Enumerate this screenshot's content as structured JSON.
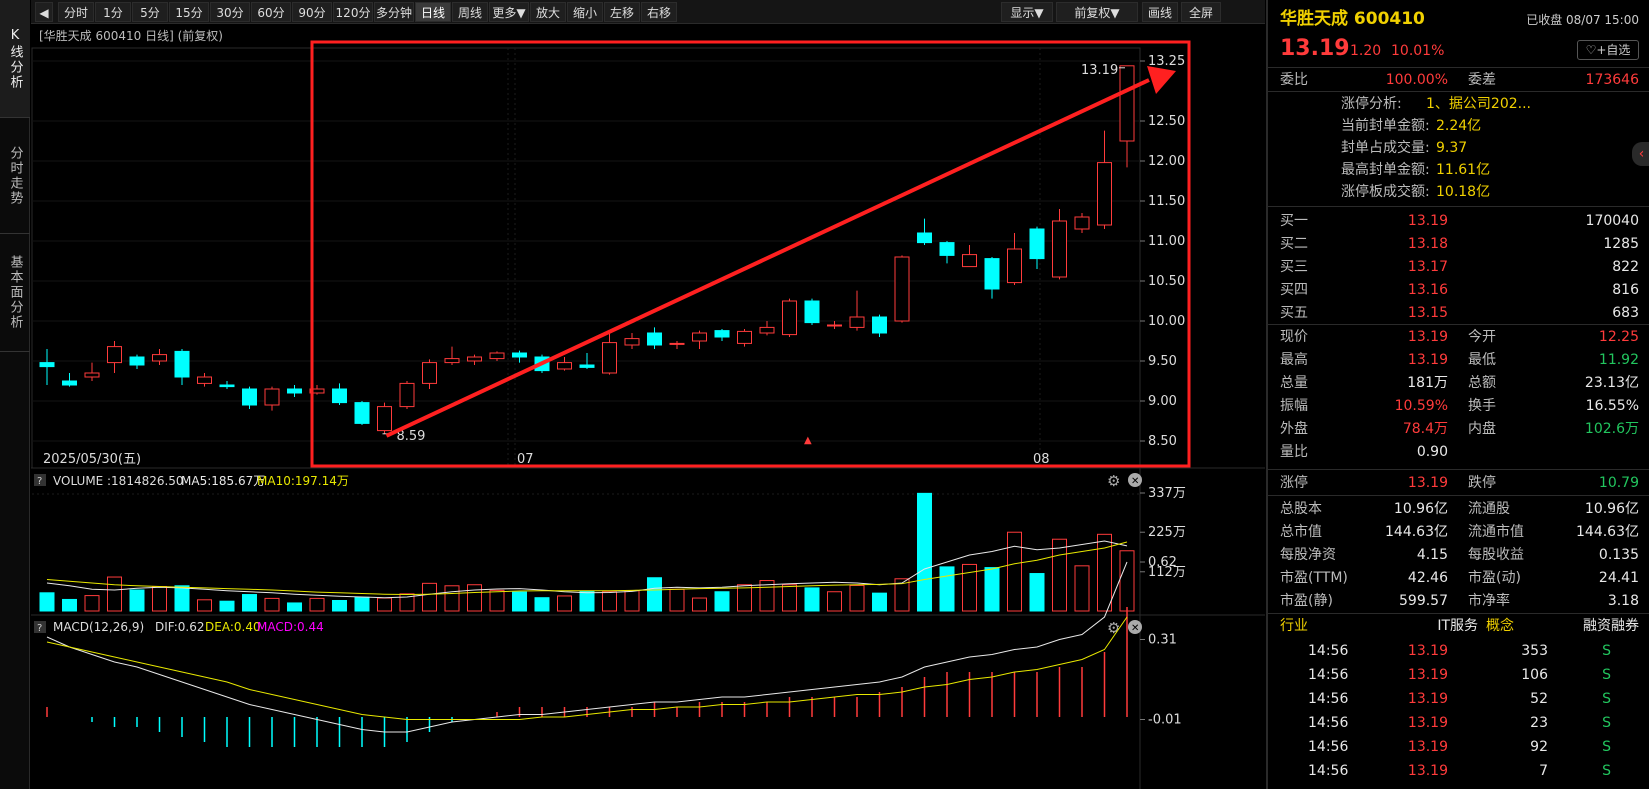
{
  "toolbar": {
    "items": [
      "分时",
      "1分",
      "5分",
      "15分",
      "30分",
      "60分",
      "90分",
      "120分",
      "多分钟",
      "日线",
      "周线",
      "更多▼",
      "放大",
      "缩小",
      "左移",
      "右移"
    ],
    "right_items": [
      "显示▼",
      "前复权▼",
      "画线",
      "全屏"
    ],
    "active": "日线"
  },
  "left_tabs": [
    "K线分析",
    "分时走势",
    "基本面分析"
  ],
  "chart": {
    "header": "[华胜天成 600410 日线] (前复权)",
    "date_label": "2025/05/30(五)",
    "month_labels": [
      "07",
      "08"
    ],
    "y_ticks": [
      "13.25",
      "12.50",
      "12.00",
      "11.50",
      "11.00",
      "10.50",
      "10.00",
      "9.50",
      "9.00",
      "8.50"
    ],
    "high_label": "13.19",
    "low_label": "8.59",
    "volume_header": {
      "name": "VOLUME",
      "value": ":1814826.50",
      "ma5": "MA5:185.67万",
      "ma10": "MA10:197.14万"
    },
    "volume_ticks": [
      "337万",
      "225万",
      "112万"
    ],
    "macd_header": {
      "name": "MACD(12,26,9)",
      "dif": "DIF:0.62",
      "dea": "DEA:0.40",
      "macd": "MACD:0.44"
    },
    "macd_ticks": [
      "0.62",
      "0.31",
      "-0.01"
    ]
  },
  "chart_data": {
    "type": "candlestick",
    "candles": [
      [
        9.48,
        9.43,
        9.65,
        9.2
      ],
      [
        9.25,
        9.2,
        9.35,
        9.18
      ],
      [
        9.3,
        9.35,
        9.48,
        9.25
      ],
      [
        9.48,
        9.68,
        9.75,
        9.35
      ],
      [
        9.55,
        9.45,
        9.58,
        9.4
      ],
      [
        9.5,
        9.58,
        9.65,
        9.45
      ],
      [
        9.62,
        9.3,
        9.65,
        9.2
      ],
      [
        9.22,
        9.3,
        9.35,
        9.18
      ],
      [
        9.2,
        9.18,
        9.25,
        9.15
      ],
      [
        9.15,
        8.95,
        9.18,
        8.9
      ],
      [
        8.95,
        9.15,
        9.18,
        8.88
      ],
      [
        9.15,
        9.1,
        9.2,
        9.05
      ],
      [
        9.1,
        9.15,
        9.2,
        9.08
      ],
      [
        9.15,
        8.98,
        9.22,
        8.95
      ],
      [
        8.98,
        8.72,
        9.0,
        8.7
      ],
      [
        8.63,
        8.93,
        8.98,
        8.59
      ],
      [
        8.93,
        9.22,
        9.25,
        8.9
      ],
      [
        9.22,
        9.48,
        9.52,
        9.15
      ],
      [
        9.48,
        9.53,
        9.68,
        9.45
      ],
      [
        9.5,
        9.55,
        9.58,
        9.45
      ],
      [
        9.53,
        9.6,
        9.62,
        9.5
      ],
      [
        9.6,
        9.55,
        9.63,
        9.48
      ],
      [
        9.55,
        9.38,
        9.58,
        9.35
      ],
      [
        9.4,
        9.48,
        9.55,
        9.38
      ],
      [
        9.45,
        9.42,
        9.6,
        9.4
      ],
      [
        9.35,
        9.73,
        9.85,
        9.33
      ],
      [
        9.7,
        9.78,
        9.85,
        9.65
      ],
      [
        9.85,
        9.7,
        9.92,
        9.65
      ],
      [
        9.72,
        9.72,
        9.75,
        9.65
      ],
      [
        9.75,
        9.85,
        9.88,
        9.65
      ],
      [
        9.88,
        9.8,
        9.9,
        9.75
      ],
      [
        9.72,
        9.87,
        9.9,
        9.68
      ],
      [
        9.85,
        9.92,
        10.0,
        9.82
      ],
      [
        9.83,
        10.25,
        10.28,
        9.8
      ],
      [
        10.25,
        9.98,
        10.28,
        9.95
      ],
      [
        9.95,
        9.95,
        10.0,
        9.9
      ],
      [
        9.92,
        10.05,
        10.38,
        9.88
      ],
      [
        10.05,
        9.85,
        10.08,
        9.8
      ],
      [
        10.0,
        10.8,
        10.82,
        9.98
      ],
      [
        11.1,
        10.98,
        11.28,
        10.95
      ],
      [
        10.98,
        10.82,
        11.0,
        10.72
      ],
      [
        10.68,
        10.83,
        10.95,
        10.68
      ],
      [
        10.78,
        10.4,
        10.8,
        10.28
      ],
      [
        10.48,
        10.9,
        11.1,
        10.45
      ],
      [
        11.15,
        10.78,
        11.18,
        10.65
      ],
      [
        10.55,
        11.25,
        11.4,
        10.52
      ],
      [
        11.15,
        11.3,
        11.35,
        11.1
      ],
      [
        11.2,
        11.98,
        12.38,
        11.15
      ],
      [
        12.25,
        13.19,
        13.19,
        11.92
      ]
    ],
    "volume": [
      52,
      33,
      44,
      97,
      60,
      70,
      72,
      32,
      28,
      47,
      36,
      23,
      36,
      30,
      39,
      37,
      49,
      79,
      72,
      75,
      59,
      54,
      38,
      43,
      56,
      55,
      58,
      95,
      62,
      37,
      55,
      75,
      87,
      75,
      66,
      55,
      73,
      51,
      92,
      336,
      126,
      133,
      124,
      225,
      107,
      205,
      129,
      219,
      172
    ],
    "vol_ma5": [
      80,
      72,
      62,
      60,
      65,
      68,
      66,
      62,
      58,
      55,
      52,
      48,
      45,
      42,
      40,
      38,
      40,
      48,
      55,
      60,
      63,
      64,
      60,
      55,
      52,
      53,
      56,
      65,
      68,
      66,
      68,
      72,
      75,
      78,
      80,
      82,
      80,
      75,
      80,
      120,
      140,
      160,
      170,
      185,
      175,
      180,
      190,
      200,
      186
    ],
    "vol_ma10": [
      90,
      85,
      80,
      75,
      72,
      70,
      68,
      66,
      64,
      62,
      60,
      57,
      54,
      52,
      50,
      48,
      47,
      48,
      50,
      53,
      55,
      57,
      58,
      58,
      58,
      58,
      59,
      60,
      62,
      64,
      65,
      66,
      68,
      70,
      72,
      74,
      75,
      76,
      78,
      90,
      100,
      110,
      120,
      135,
      145,
      160,
      170,
      180,
      197
    ],
    "dif": [
      0.32,
      0.28,
      0.25,
      0.22,
      0.2,
      0.17,
      0.14,
      0.11,
      0.08,
      0.05,
      0.03,
      0.01,
      -0.01,
      -0.03,
      -0.05,
      -0.06,
      -0.06,
      -0.04,
      -0.02,
      -0.01,
      0.0,
      0.01,
      0.01,
      0.02,
      0.03,
      0.04,
      0.05,
      0.06,
      0.06,
      0.07,
      0.08,
      0.08,
      0.09,
      0.1,
      0.11,
      0.12,
      0.13,
      0.14,
      0.16,
      0.2,
      0.22,
      0.24,
      0.25,
      0.27,
      0.28,
      0.31,
      0.33,
      0.4,
      0.62
    ],
    "dea": [
      0.3,
      0.28,
      0.26,
      0.24,
      0.22,
      0.2,
      0.18,
      0.16,
      0.14,
      0.11,
      0.09,
      0.07,
      0.05,
      0.03,
      0.01,
      0.0,
      -0.01,
      -0.01,
      -0.01,
      -0.01,
      -0.01,
      -0.01,
      0.0,
      0.0,
      0.01,
      0.02,
      0.03,
      0.03,
      0.04,
      0.04,
      0.05,
      0.05,
      0.06,
      0.06,
      0.07,
      0.08,
      0.09,
      0.09,
      0.1,
      0.12,
      0.13,
      0.15,
      0.16,
      0.18,
      0.19,
      0.21,
      0.23,
      0.27,
      0.4
    ],
    "macd": [
      0.04,
      0.0,
      -0.02,
      -0.04,
      -0.04,
      -0.06,
      -0.08,
      -0.1,
      -0.12,
      -0.12,
      -0.12,
      -0.12,
      -0.12,
      -0.12,
      -0.12,
      -0.12,
      -0.1,
      -0.06,
      -0.02,
      0.0,
      0.02,
      0.04,
      0.04,
      0.04,
      0.04,
      0.04,
      0.04,
      0.06,
      0.04,
      0.06,
      0.06,
      0.06,
      0.06,
      0.08,
      0.08,
      0.08,
      0.08,
      0.1,
      0.12,
      0.16,
      0.18,
      0.18,
      0.18,
      0.18,
      0.18,
      0.2,
      0.2,
      0.26,
      0.44
    ],
    "ylim": [
      8.4,
      13.3
    ],
    "vol_max": 337
  },
  "right": {
    "title": "华胜天成 600410",
    "status": "已收盘 08/07 15:00",
    "price": "13.19",
    "change": "1.20",
    "pct": "10.01%",
    "favorite": "+自选",
    "weibi_label": "委比",
    "weibi": "100.00%",
    "weicha_label": "委差",
    "weicha": "173646",
    "analysis": [
      {
        "label": "涨停分析:",
        "value": "1、据公司202..."
      },
      {
        "label": "当前封单金额:",
        "value": "2.24亿"
      },
      {
        "label": "封单占成交量:",
        "value": "9.37"
      },
      {
        "label": "最高封单金额:",
        "value": "11.61亿"
      },
      {
        "label": "涨停板成交额:",
        "value": "10.18亿"
      }
    ],
    "bids": [
      {
        "label": "买一",
        "price": "13.19",
        "vol": "170040"
      },
      {
        "label": "买二",
        "price": "13.18",
        "vol": "1285"
      },
      {
        "label": "买三",
        "price": "13.17",
        "vol": "822"
      },
      {
        "label": "买四",
        "price": "13.16",
        "vol": "816"
      },
      {
        "label": "买五",
        "price": "13.15",
        "vol": "683"
      }
    ],
    "quote": [
      [
        {
          "l": "现价",
          "v": "13.19",
          "c": "red"
        },
        {
          "l": "今开",
          "v": "12.25",
          "c": "red"
        }
      ],
      [
        {
          "l": "最高",
          "v": "13.19",
          "c": "red"
        },
        {
          "l": "最低",
          "v": "11.92",
          "c": "green"
        }
      ],
      [
        {
          "l": "总量",
          "v": "181万",
          "c": "white"
        },
        {
          "l": "总额",
          "v": "23.13亿",
          "c": "white"
        }
      ],
      [
        {
          "l": "振幅",
          "v": "10.59%",
          "c": "red"
        },
        {
          "l": "换手",
          "v": "16.55%",
          "c": "white"
        }
      ],
      [
        {
          "l": "外盘",
          "v": "78.4万",
          "c": "red"
        },
        {
          "l": "内盘",
          "v": "102.6万",
          "c": "green"
        }
      ],
      [
        {
          "l": "量比",
          "v": "0.90",
          "c": "white"
        }
      ]
    ],
    "limits": [
      {
        "l": "涨停",
        "v": "13.19",
        "c": "red"
      },
      {
        "l": "跌停",
        "v": "10.79",
        "c": "green"
      }
    ],
    "fundamentals": [
      [
        {
          "l": "总股本",
          "v": "10.96亿"
        },
        {
          "l": "流通股",
          "v": "10.96亿"
        }
      ],
      [
        {
          "l": "总市值",
          "v": "144.63亿"
        },
        {
          "l": "流通市值",
          "v": "144.63亿"
        }
      ],
      [
        {
          "l": "每股净资",
          "v": "4.15"
        },
        {
          "l": "每股收益",
          "v": "0.135"
        }
      ],
      [
        {
          "l": "市盈(TTM)",
          "v": "42.46"
        },
        {
          "l": "市盈(动)",
          "v": "24.41"
        }
      ],
      [
        {
          "l": "市盈(静)",
          "v": "599.57"
        },
        {
          "l": "市净率",
          "v": "3.18"
        }
      ]
    ],
    "industry": {
      "label": "行业",
      "value": "IT服务",
      "concept": "概念",
      "margin": "融资融券"
    },
    "trades": [
      {
        "t": "14:56",
        "p": "13.19",
        "v": "353",
        "s": "S"
      },
      {
        "t": "14:56",
        "p": "13.19",
        "v": "106",
        "s": "S"
      },
      {
        "t": "14:56",
        "p": "13.19",
        "v": "52",
        "s": "S"
      },
      {
        "t": "14:56",
        "p": "13.19",
        "v": "23",
        "s": "S"
      },
      {
        "t": "14:56",
        "p": "13.19",
        "v": "92",
        "s": "S"
      },
      {
        "t": "14:56",
        "p": "13.19",
        "v": "7",
        "s": "S"
      }
    ]
  },
  "colors": {
    "up": "#ff3b3b",
    "down": "#00ffff",
    "annot": "#ff2020",
    "ma5": "#e8e8e8",
    "ma10": "#e8e800",
    "macd": "#ff00ff"
  }
}
